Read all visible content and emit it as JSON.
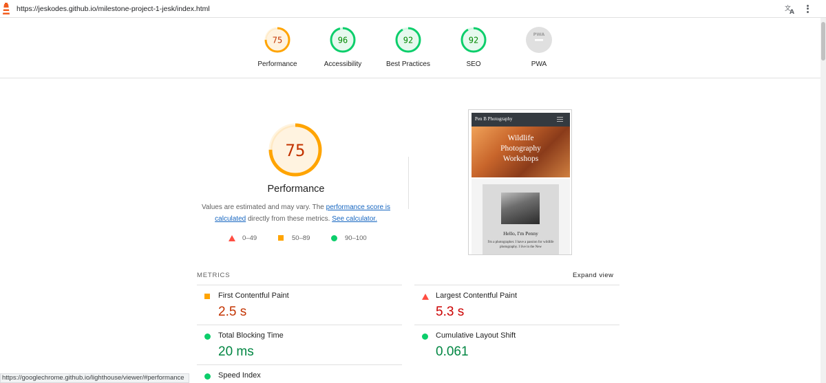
{
  "browser": {
    "url": "https://jeskodes.github.io/milestone-project-1-jesk/index.html",
    "status_url": "https://googlechrome.github.io/lighthouse/viewer/#performance",
    "icons": [
      "lighthouse-logo-icon",
      "translate-icon",
      "menu-kebab-icon"
    ]
  },
  "gauges": [
    {
      "label": "Performance",
      "score": "75",
      "level": 0.75,
      "color": "#ffa400",
      "bg": "#fff3e0",
      "text_color": "#c33300"
    },
    {
      "label": "Accessibility",
      "score": "96",
      "level": 0.96,
      "color": "#0cce6b",
      "bg": "#e6f9ee",
      "text_color": "#008800"
    },
    {
      "label": "Best Practices",
      "score": "92",
      "level": 0.92,
      "color": "#0cce6b",
      "bg": "#e6f9ee",
      "text_color": "#008800"
    },
    {
      "label": "SEO",
      "score": "92",
      "level": 0.92,
      "color": "#0cce6b",
      "bg": "#e6f9ee",
      "text_color": "#008800"
    },
    {
      "label": "PWA",
      "score": "",
      "badge": "PWA",
      "color": "#bdbdbd"
    }
  ],
  "performance": {
    "score": "75",
    "level": 0.75,
    "title": "Performance",
    "desc_before": "Values are estimated and may vary. The ",
    "link1": "performance score is calculated",
    "desc_middle": " directly from these metrics. ",
    "link2": "See calculator."
  },
  "legend": [
    {
      "marker": "triangle",
      "range": "0–49",
      "color": "#ff4e42"
    },
    {
      "marker": "square",
      "range": "50–89",
      "color": "#ffa400"
    },
    {
      "marker": "circle",
      "range": "90–100",
      "color": "#0cce6b"
    }
  ],
  "preview": {
    "nav_title": "Pen B Photography",
    "hero_lines": [
      "Wildlife",
      "Photography",
      "Workshops"
    ],
    "hello": "Hello, I'm Penny",
    "intro": "I'm a photographer. I have a passion for wildlife photography. I live in the New"
  },
  "metrics": {
    "header": "METRICS",
    "expand": "Expand view",
    "items": [
      {
        "name": "First Contentful Paint",
        "value": "2.5 s",
        "rating": "average"
      },
      {
        "name": "Largest Contentful Paint",
        "value": "5.3 s",
        "rating": "fail"
      },
      {
        "name": "Total Blocking Time",
        "value": "20 ms",
        "rating": "pass"
      },
      {
        "name": "Cumulative Layout Shift",
        "value": "0.061",
        "rating": "pass"
      },
      {
        "name": "Speed Index",
        "value": "",
        "rating": "pass"
      }
    ]
  },
  "colors": {
    "pass": "#0cce6b",
    "average": "#ffa400",
    "fail": "#ff4e42",
    "link": "#1565c0"
  }
}
